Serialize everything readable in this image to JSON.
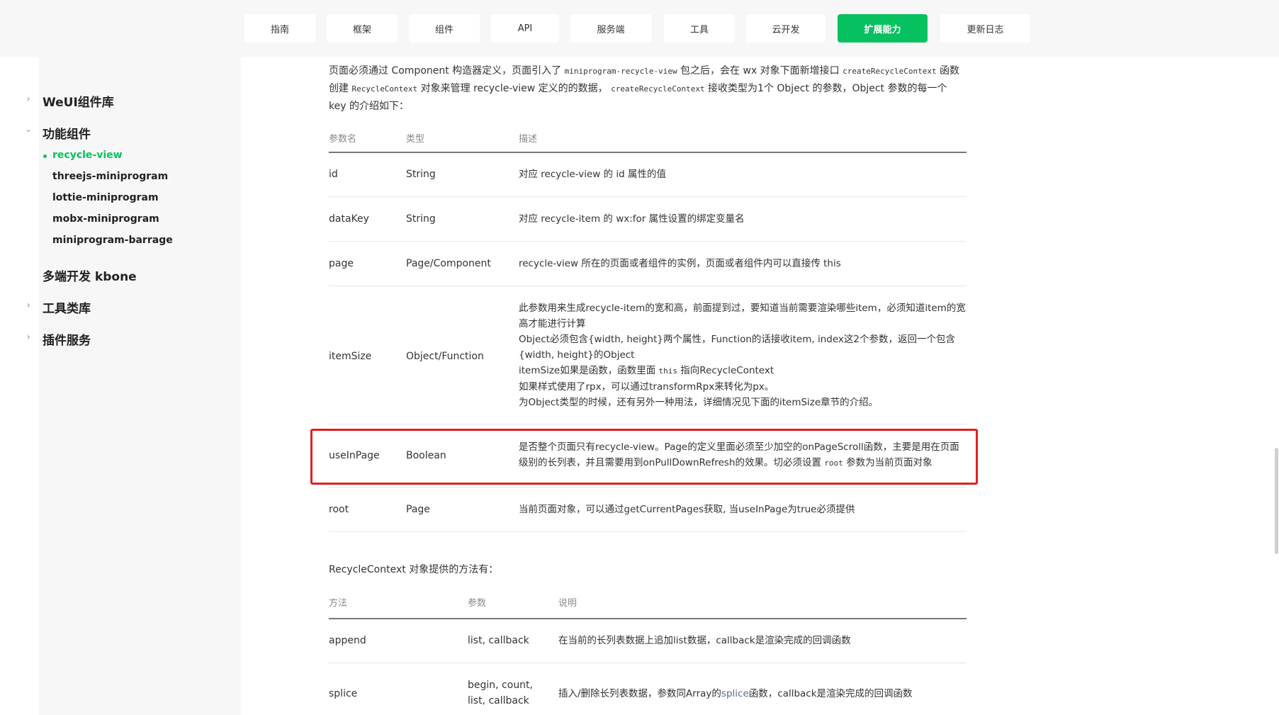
{
  "nav": {
    "tabs": [
      {
        "label": "指南"
      },
      {
        "label": "框架"
      },
      {
        "label": "组件"
      },
      {
        "label": "API"
      },
      {
        "label": "服务端"
      },
      {
        "label": "工具"
      },
      {
        "label": "云开发"
      },
      {
        "label": "扩展能力"
      },
      {
        "label": "更新日志"
      }
    ],
    "active_tab": "扩展能力"
  },
  "sidebar": {
    "weui": "WeUI组件库",
    "functional": "功能组件",
    "sub_items": [
      "recycle-view",
      "threejs-miniprogram",
      "lottie-miniprogram",
      "mobx-miniprogram",
      "miniprogram-barrage"
    ],
    "kbone": "多端开发 kbone",
    "tools": "工具类库",
    "plugins": "插件服务"
  },
  "intro": {
    "p1": "页面必须通过 Component 构造器定义，页面引入了 ",
    "code1": "miniprogram-recycle-view",
    "p2": " 包之后，会在 wx 对象下面新增接口 ",
    "code2": "createRecycleContext",
    "p3": " 函数创建 ",
    "code3": "RecycleContext",
    "p4": " 对象来管理 recycle-view 定义的的数据， ",
    "code4": "createRecycleContext",
    "p5": " 接收类型为1个 Object 的参数，Object 参数的每一个 key 的介绍如下："
  },
  "params_table": {
    "headers": [
      "参数名",
      "类型",
      "描述"
    ],
    "rows": [
      {
        "name": "id",
        "type": "String",
        "desc": "对应 recycle-view 的 id 属性的值"
      },
      {
        "name": "dataKey",
        "type": "String",
        "desc": "对应 recycle-item 的 wx:for 属性设置的绑定变量名"
      },
      {
        "name": "page",
        "type": "Page/Component",
        "desc": "recycle-view 所在的页面或者组件的实例，页面或者组件内可以直接传 this"
      },
      {
        "name": "itemSize",
        "type": "Object/Function",
        "desc_l1": "此参数用来生成recycle-item的宽和高，前面提到过，要知道当前需要渲染哪些item，必须知道item的宽高才能进行计算",
        "desc_l2": "Object必须包含{width, height}两个属性，Function的话接收item, index这2个参数，返回一个包含{width, height}的Object",
        "desc_l3a": "itemSize如果是函数，函数里面 ",
        "desc_l3code": "this",
        "desc_l3b": " 指向RecycleContext",
        "desc_l4": "如果样式使用了rpx，可以通过transformRpx来转化为px。",
        "desc_l5": "为Object类型的时候，还有另外一种用法，详细情况见下面的itemSize章节的介绍。"
      },
      {
        "name": "useInPage",
        "type": "Boolean",
        "desc_a": "是否整个页面只有recycle-view。Page的定义里面必须至少加空的onPageScroll函数，主要是用在页面级别的长列表，并且需要用到onPullDownRefresh的效果。切必须设置 ",
        "desc_code": "root",
        "desc_b": " 参数为当前页面对象"
      },
      {
        "name": "root",
        "type": "Page",
        "desc": "当前页面对象，可以通过getCurrentPages获取, 当useInPage为true必须提供"
      }
    ]
  },
  "methods_intro": "RecycleContext 对象提供的方法有：",
  "methods_table": {
    "headers": [
      "方法",
      "参数",
      "说明"
    ],
    "rows": [
      {
        "name": "append",
        "params": "list, callback",
        "desc": "在当前的长列表数据上追加list数据，callback是渲染完成的回调函数"
      },
      {
        "name": "splice",
        "params_l1": "begin, count,",
        "params_l2": "list, callback",
        "desc_a": "插入/删除长列表数据，参数同Array的",
        "desc_link": "splice",
        "desc_b": "函数，callback是渲染完成的回调函数"
      }
    ]
  },
  "colors": {
    "accent": "#07c160",
    "highlight": "#e02020",
    "link": "#576b95"
  }
}
